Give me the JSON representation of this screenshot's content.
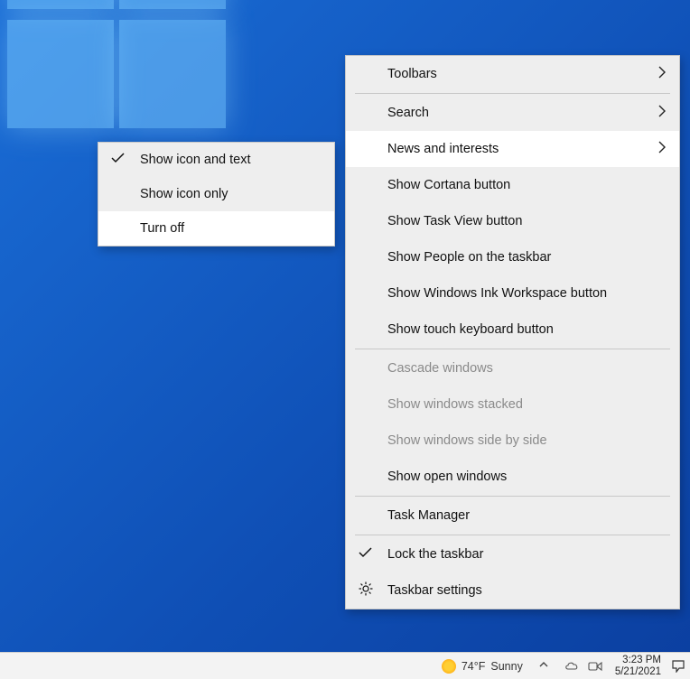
{
  "taskbar": {
    "weather_temp": "74°F",
    "weather_label": "Sunny",
    "time": "3:23 PM",
    "date": "5/21/2021"
  },
  "main_menu": {
    "toolbars": "Toolbars",
    "search": "Search",
    "news_interests": "News and interests",
    "cortana": "Show Cortana button",
    "taskview": "Show Task View button",
    "people": "Show People on the taskbar",
    "ink": "Show Windows Ink Workspace button",
    "touchkb": "Show touch keyboard button",
    "cascade": "Cascade windows",
    "stacked": "Show windows stacked",
    "sidebyside": "Show windows side by side",
    "showopen": "Show open windows",
    "taskmgr": "Task Manager",
    "lock": "Lock the taskbar",
    "settings": "Taskbar settings"
  },
  "sub_menu": {
    "icon_text": "Show icon and text",
    "icon_only": "Show icon only",
    "turn_off": "Turn off"
  }
}
